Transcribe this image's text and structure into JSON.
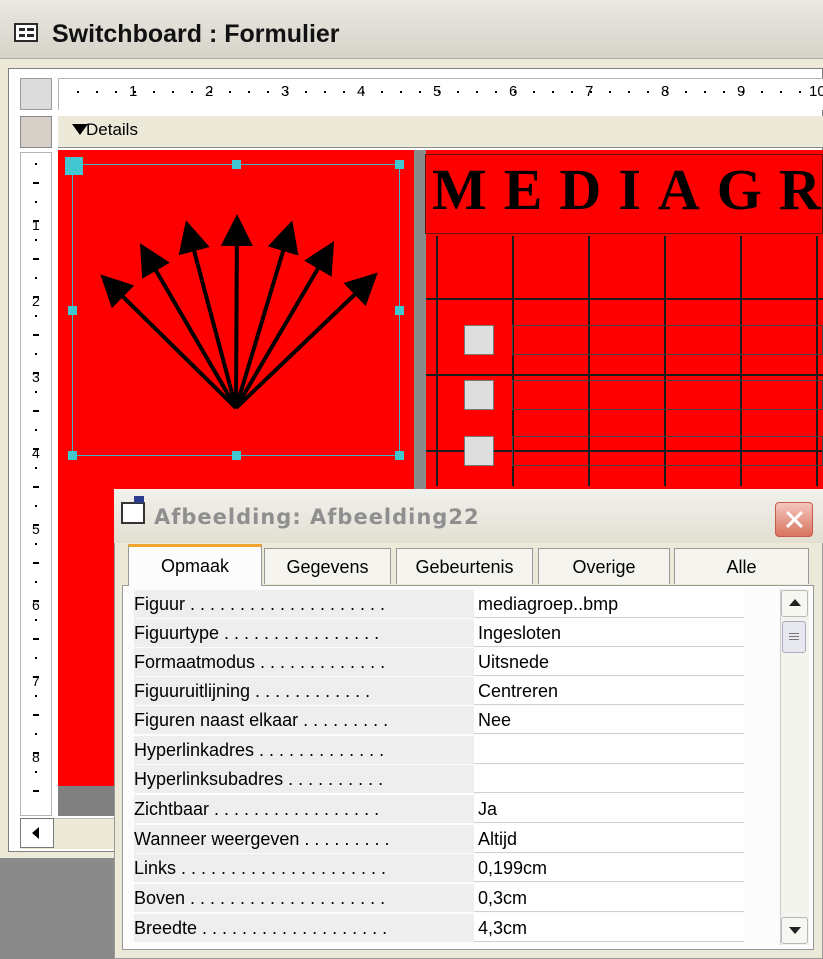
{
  "window": {
    "title": "Switchboard : Formulier"
  },
  "ruler": {
    "h_numbers": [
      "1",
      "2",
      "3",
      "4",
      "5",
      "6",
      "7",
      "8",
      "9",
      "10"
    ],
    "v_numbers": [
      "1",
      "2",
      "3",
      "4",
      "5",
      "6",
      "7",
      "8"
    ]
  },
  "section": {
    "label": "Details"
  },
  "form": {
    "header_text": "MEDIAGR",
    "background_color": "#ff0000"
  },
  "dialog": {
    "title": "Afbeelding: Afbeelding22",
    "tabs": [
      "Opmaak",
      "Gegevens",
      "Gebeurtenis",
      "Overige",
      "Alle"
    ],
    "active_tab": "Opmaak",
    "properties": [
      {
        "label": "Figuur . . . . . . . . . . . . . . . . . . . .",
        "value": "mediagroep..bmp"
      },
      {
        "label": "Figuurtype . . . . . . . . . . . . . . . .",
        "value": "Ingesloten"
      },
      {
        "label": "Formaatmodus . . . . . . . . . . . . .",
        "value": "Uitsnede"
      },
      {
        "label": "Figuuruitlijning . . . . . . . . . . . .",
        "value": "Centreren"
      },
      {
        "label": "Figuren naast elkaar . . . . . . . . .",
        "value": "Nee"
      },
      {
        "label": "Hyperlinkadres . . . . . . . . . . . . .",
        "value": ""
      },
      {
        "label": "Hyperlinksubadres . . . . . . . . . .",
        "value": ""
      },
      {
        "label": "Zichtbaar . . . . . . . . . . . . . . . . .",
        "value": "Ja"
      },
      {
        "label": "Wanneer weergeven . . . . . . . . .",
        "value": "Altijd"
      },
      {
        "label": "Links . . . . . . . . . . . . . . . . . . . . .",
        "value": "0,199cm"
      },
      {
        "label": "Boven . . . . . . . . . . . . . . . . . . . .",
        "value": "0,3cm"
      },
      {
        "label": "Breedte . . . . . . . . . . . . . . . . . . .",
        "value": "4,3cm"
      }
    ]
  }
}
